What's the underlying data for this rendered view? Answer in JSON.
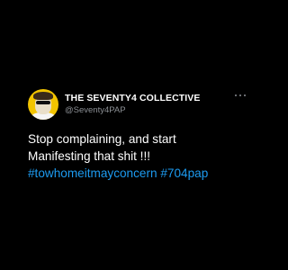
{
  "tweet": {
    "display_name": "THE SEVENTY4 COLLECTIVE",
    "handle": "@Seventy4PAP",
    "avatar_icon": "avatar-illustration-icon",
    "more_icon": "more-options-icon",
    "text_line1": "Stop complaining, and start",
    "text_line2": "Manifesting that shit !!!",
    "hashtag1": "#towhomeitmayconcern",
    "hashtag2": "#704pap"
  },
  "colors": {
    "background": "#000000",
    "text": "#ffffff",
    "handle": "#8b8f94",
    "hashtag": "#1d9bf0",
    "avatar_bg": "#f2c400"
  }
}
